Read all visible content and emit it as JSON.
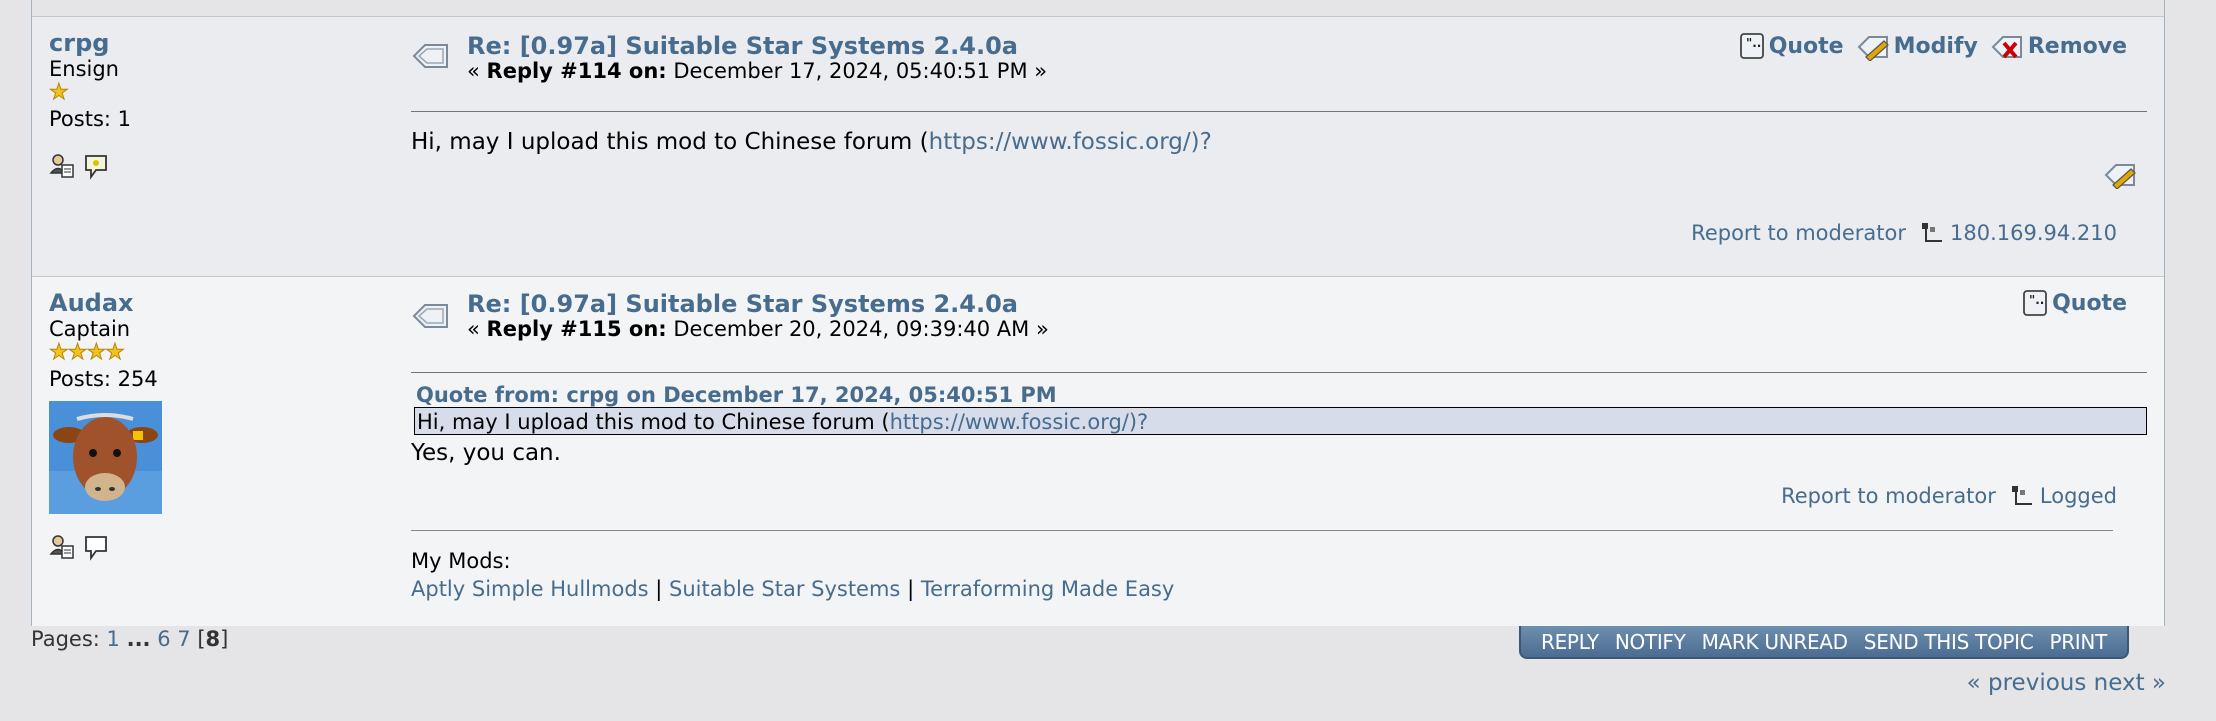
{
  "posts": [
    {
      "username": "crpg",
      "rank": "Ensign",
      "stars": "★",
      "posts_label": "Posts: 1",
      "subject": "Re: [0.97a] Suitable Star Systems 2.4.0a",
      "reply_prefix": "« ",
      "reply_label": "Reply #114 on:",
      "reply_date": " December 17, 2024, 05:40:51 PM »",
      "actions": {
        "quote": "Quote",
        "modify": "Modify",
        "remove": "Remove"
      },
      "body_prefix": "Hi, may I upload this mod to Chinese forum (",
      "body_link": "https://www.fossic.org/)?",
      "report": "Report to moderator",
      "ip": "180.169.94.210"
    },
    {
      "username": "Audax",
      "rank": "Captain",
      "stars": "★★★★",
      "posts_label": "Posts: 254",
      "subject": "Re: [0.97a] Suitable Star Systems 2.4.0a",
      "reply_prefix": "« ",
      "reply_label": "Reply #115 on:",
      "reply_date": " December 20, 2024, 09:39:40 AM »",
      "actions": {
        "quote": "Quote"
      },
      "quote_header": "Quote from: crpg on December 17, 2024, 05:40:51 PM",
      "quote_prefix": "Hi, may I upload this mod to Chinese forum (",
      "quote_link": "https://www.fossic.org/)?",
      "body": "Yes, you can.",
      "report": "Report to moderator",
      "logged": "Logged",
      "signature": {
        "heading": "My Mods:",
        "mods": [
          "Aptly Simple Hullmods",
          "Suitable Star Systems",
          "Terraforming Made Easy"
        ],
        "separator": "|"
      }
    }
  ],
  "pagination": {
    "label": "Pages: ",
    "first": "1",
    "ellipsis": "...",
    "p6": "6",
    "p7": "7",
    "current_open": "[",
    "current": "8",
    "current_close": "]"
  },
  "buttons": [
    "REPLY",
    "NOTIFY",
    "MARK UNREAD",
    "SEND THIS TOPIC",
    "PRINT"
  ],
  "nav": {
    "previous": "« previous",
    "next": "next »"
  },
  "colors": {
    "link": "#476c8e",
    "button_bar": "#4b6c91",
    "quote_bg": "#d7dcea"
  }
}
